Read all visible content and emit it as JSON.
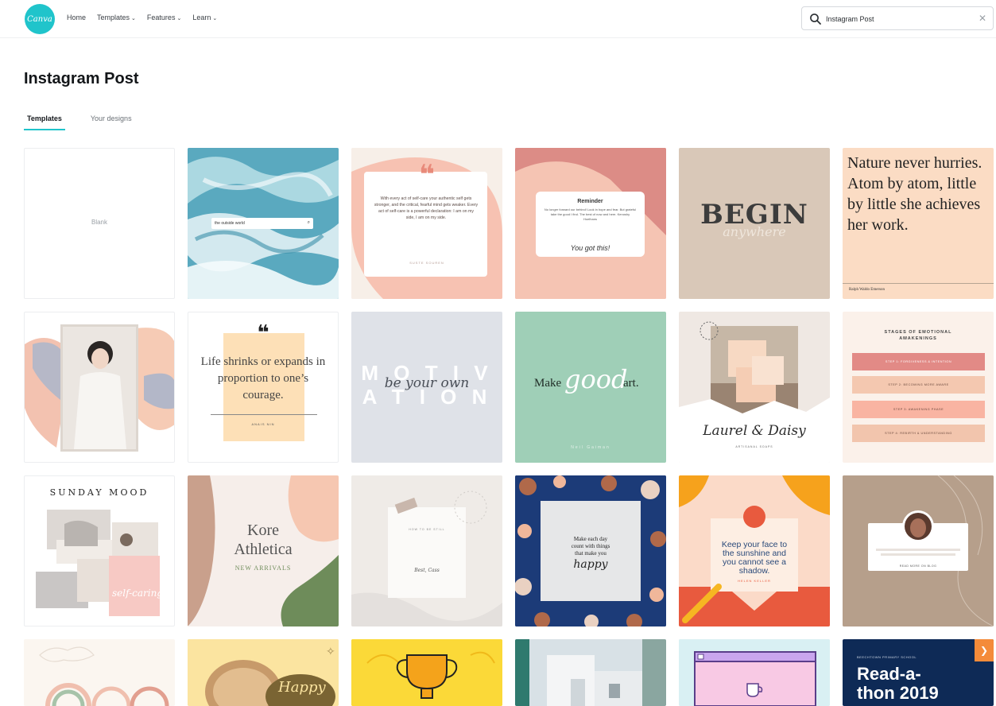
{
  "nav": {
    "logo_text": "Canva",
    "items": [
      "Home",
      "Templates",
      "Features",
      "Learn"
    ],
    "search_value": "Instagram Post"
  },
  "page": {
    "title": "Instagram Post",
    "tabs": [
      "Templates",
      "Your designs"
    ]
  },
  "tiles": {
    "blank": "Blank",
    "ocean_search": "the outside world",
    "quote1_text": "With every act of self-care your authentic self gets stronger, and the critical, fearful mind gets weaker. Every act of self-care is a powerful declaration: I am on my side, I am on my side.",
    "quote1_author": "SUSTE SOUREN",
    "reminder_title": "Reminder",
    "reminder_body": "No longer forward our behind! Look in hope and fear. But grateful take the good I find. The best of now and here. Kenoshy Hoelhans",
    "reminder_sign": "You got this!",
    "begin": "BEGIN",
    "begin_script": "anywhere",
    "nature_quote": "Nature never hurries. Atom by atom, little by little she achieves her work.",
    "nature_author": "Ralph Waldo Emerson",
    "life_quote": "Life shrinks or expands in proportion to one’s courage.",
    "life_author": "ANAIS NIN",
    "motiv_1": "M O T I V",
    "motiv_2": "A T I O N",
    "motiv_script": "be your own",
    "make_1": "Make",
    "make_script": "good",
    "make_2": "art.",
    "make_author": "Neil Gaiman",
    "laurel": "Laurel & Daisy",
    "laurel_sub": "ARTISANAL SOAPS",
    "stages_title": "STAGES OF EMOTIONAL AWAKENINGS",
    "stages": [
      "STEP 1: FORGIVENESS & INTENTION",
      "STEP 2: BECOMING MORE AWARE",
      "STEP 3: AWAKENING PHASE",
      "STEP 4: REBIRTH & UNDERSTANDING"
    ],
    "sunday": "SUNDAY MOOD",
    "sunday_script": "self-caring",
    "kore_1": "Kore",
    "kore_2": "Athletica",
    "kore_sub": "NEW ARRIVALS",
    "note_title": "HOW TO BE STILL",
    "note_sign": "Best, Cass",
    "dots_1": "Make each day",
    "dots_2": "count with things",
    "dots_3": "that make you",
    "dots_script": "happy",
    "keller": "Keep your face to the sunshine and you cannot see a shadow.",
    "keller_author": "HELEN KELLER",
    "profile_btn": "READ MORE ON BLOG",
    "happy": "Happy",
    "read_school": "BEECHTOWN PRIMARY SCHOOL",
    "read_title_1": "Read-a-",
    "read_title_2": "thon 2019"
  },
  "colors": {
    "brand": "#20c4cb",
    "salmon": "#f6bfb0",
    "tan": "#dacbbd",
    "mint": "#9fcfb7",
    "navy": "#0e2a56"
  }
}
